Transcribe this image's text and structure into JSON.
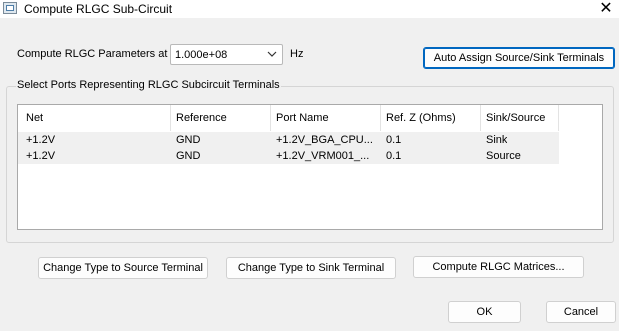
{
  "window": {
    "title": "Compute RLGC Sub-Circuit",
    "close_glyph": "✕"
  },
  "params": {
    "label": "Compute RLGC Parameters at",
    "frequency": "1.000e+08",
    "unit": "Hz",
    "auto_assign_label": "Auto Assign Source/Sink Terminals"
  },
  "ports": {
    "group_title": "Select Ports Representing RLGC Subcircuit Terminals",
    "columns": [
      "Net",
      "Reference",
      "Port Name",
      "Ref. Z (Ohms)",
      "Sink/Source"
    ],
    "rows": [
      [
        "+1.2V",
        "GND",
        "+1.2V_BGA_CPU...",
        "0.1",
        "Sink"
      ],
      [
        "+1.2V",
        "GND",
        "+1.2V_VRM001_...",
        "0.1",
        "Source"
      ]
    ]
  },
  "actions": {
    "source_label": "Change Type to Source Terminal",
    "sink_label": "Change Type to Sink Terminal",
    "compute_label": "Compute RLGC Matrices..."
  },
  "dialog": {
    "ok_label": "OK",
    "cancel_label": "Cancel"
  },
  "icons": {
    "app": "window-icon",
    "close": "close-icon",
    "dropdown": "chevron-down-icon"
  },
  "colors": {
    "default_button_border": "#0067c0",
    "row_background": "#f0f0f0",
    "dialog_background": "#f0f0f0"
  }
}
